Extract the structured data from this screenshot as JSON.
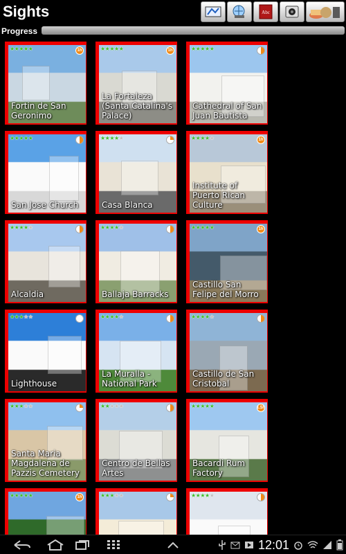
{
  "app": {
    "title": "Sights",
    "progress_label": "Progress",
    "progress_value": 0.0,
    "toolbar": [
      "map-icon",
      "globe-search-icon",
      "dictionary-icon",
      "camera-icon",
      "food-icon"
    ]
  },
  "tiles": [
    {
      "label": "Fortin de San Geronimo",
      "stars": 5,
      "badge": "1h"
    },
    {
      "label": "La Fortaleza (Santa Catalina's Palace)",
      "stars": 5,
      "badge": "1h"
    },
    {
      "label": "Cathedral of San Juan Bautista",
      "stars": 5,
      "badge": "pie"
    },
    {
      "label": "San Jose Church",
      "stars": 5,
      "badge": "pie"
    },
    {
      "label": "Casa Blanca",
      "stars": 4,
      "badge": "pie"
    },
    {
      "label": "Institute of Puerto Rican Culture",
      "stars": 4,
      "badge": "1h"
    },
    {
      "label": "Alcaldia",
      "stars": 4,
      "badge": "pie"
    },
    {
      "label": "Ballaja Barracks",
      "stars": 4,
      "badge": "pie"
    },
    {
      "label": "Castillo San Felipe del Morro",
      "stars": 5,
      "badge": "1h"
    },
    {
      "label": "Lighthouse",
      "stars": 3,
      "badge": "empty"
    },
    {
      "label": "La Muralla - National Park",
      "stars": 4,
      "badge": "pie"
    },
    {
      "label": "Castillo de San Cristobal",
      "stars": 4,
      "badge": "pie"
    },
    {
      "label": "Santa Maria Magdalena de Pazzis Cemetery",
      "stars": 3,
      "badge": "pie"
    },
    {
      "label": "Centro de Bellas Artes",
      "stars": 2,
      "badge": "pie"
    },
    {
      "label": "Bacardi Rum Factory",
      "stars": 5,
      "badge": "1.5h"
    },
    {
      "label": "",
      "stars": 5,
      "badge": "1h"
    },
    {
      "label": "",
      "stars": 3,
      "badge": "pie"
    },
    {
      "label": "",
      "stars": 4,
      "badge": "pie"
    }
  ],
  "status": {
    "clock": "12:01"
  }
}
